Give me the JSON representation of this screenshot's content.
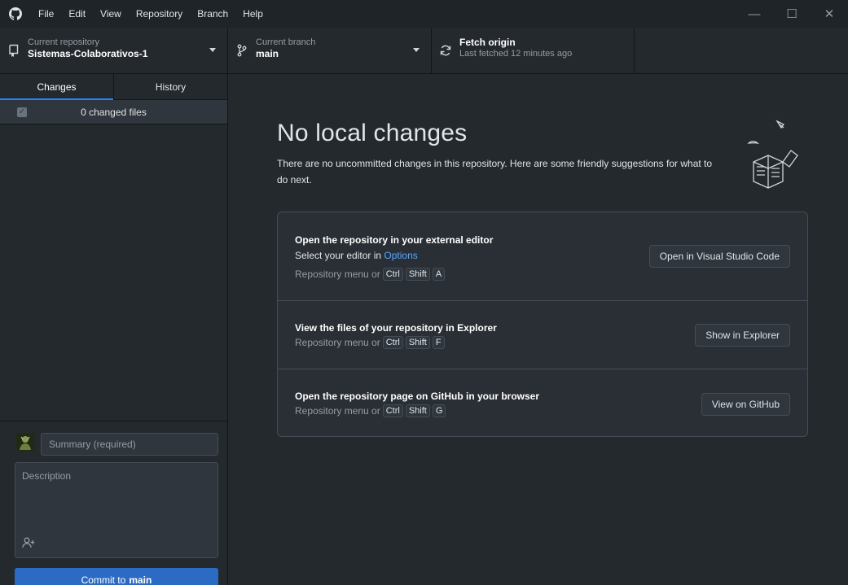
{
  "menu": {
    "items": [
      "File",
      "Edit",
      "View",
      "Repository",
      "Branch",
      "Help"
    ]
  },
  "window_controls": {
    "minimize": "—",
    "maximize": "☐",
    "close": "✕"
  },
  "toolbar": {
    "repo_title": "Current repository",
    "repo_value": "Sistemas-Colaborativos-1",
    "branch_title": "Current branch",
    "branch_value": "main",
    "fetch_title": "Fetch origin",
    "fetch_status": "Last fetched 12 minutes ago"
  },
  "sidebar": {
    "tabs": [
      {
        "label": "Changes",
        "active": true
      },
      {
        "label": "History",
        "active": false
      }
    ],
    "changes_count": "0 changed files",
    "checkbox_mark": "✓"
  },
  "commit": {
    "summary_placeholder": "Summary (required)",
    "description_placeholder": "Description",
    "button_prefix": "Commit to",
    "button_branch": "main"
  },
  "main": {
    "heading": "No local changes",
    "subtext": "There are no uncommitted changes in this repository. Here are some friendly suggestions for what to do next.",
    "cards": [
      {
        "title": "Open the repository in your external editor",
        "sub_prefix": "Select your editor in",
        "sub_link": "Options",
        "shortcut_prefix": "Repository menu or",
        "keys": [
          "Ctrl",
          "Shift",
          "A"
        ],
        "button": "Open in Visual Studio Code"
      },
      {
        "title": "View the files of your repository in Explorer",
        "shortcut_prefix": "Repository menu or",
        "keys": [
          "Ctrl",
          "Shift",
          "F"
        ],
        "button": "Show in Explorer"
      },
      {
        "title": "Open the repository page on GitHub in your browser",
        "shortcut_prefix": "Repository menu or",
        "keys": [
          "Ctrl",
          "Shift",
          "G"
        ],
        "button": "View on GitHub"
      }
    ]
  },
  "colors": {
    "background": "#24292e",
    "titlebar": "#1f2428",
    "accent": "#2188ff",
    "commit_button": "#2b6bc4",
    "link": "#58a6ff"
  }
}
